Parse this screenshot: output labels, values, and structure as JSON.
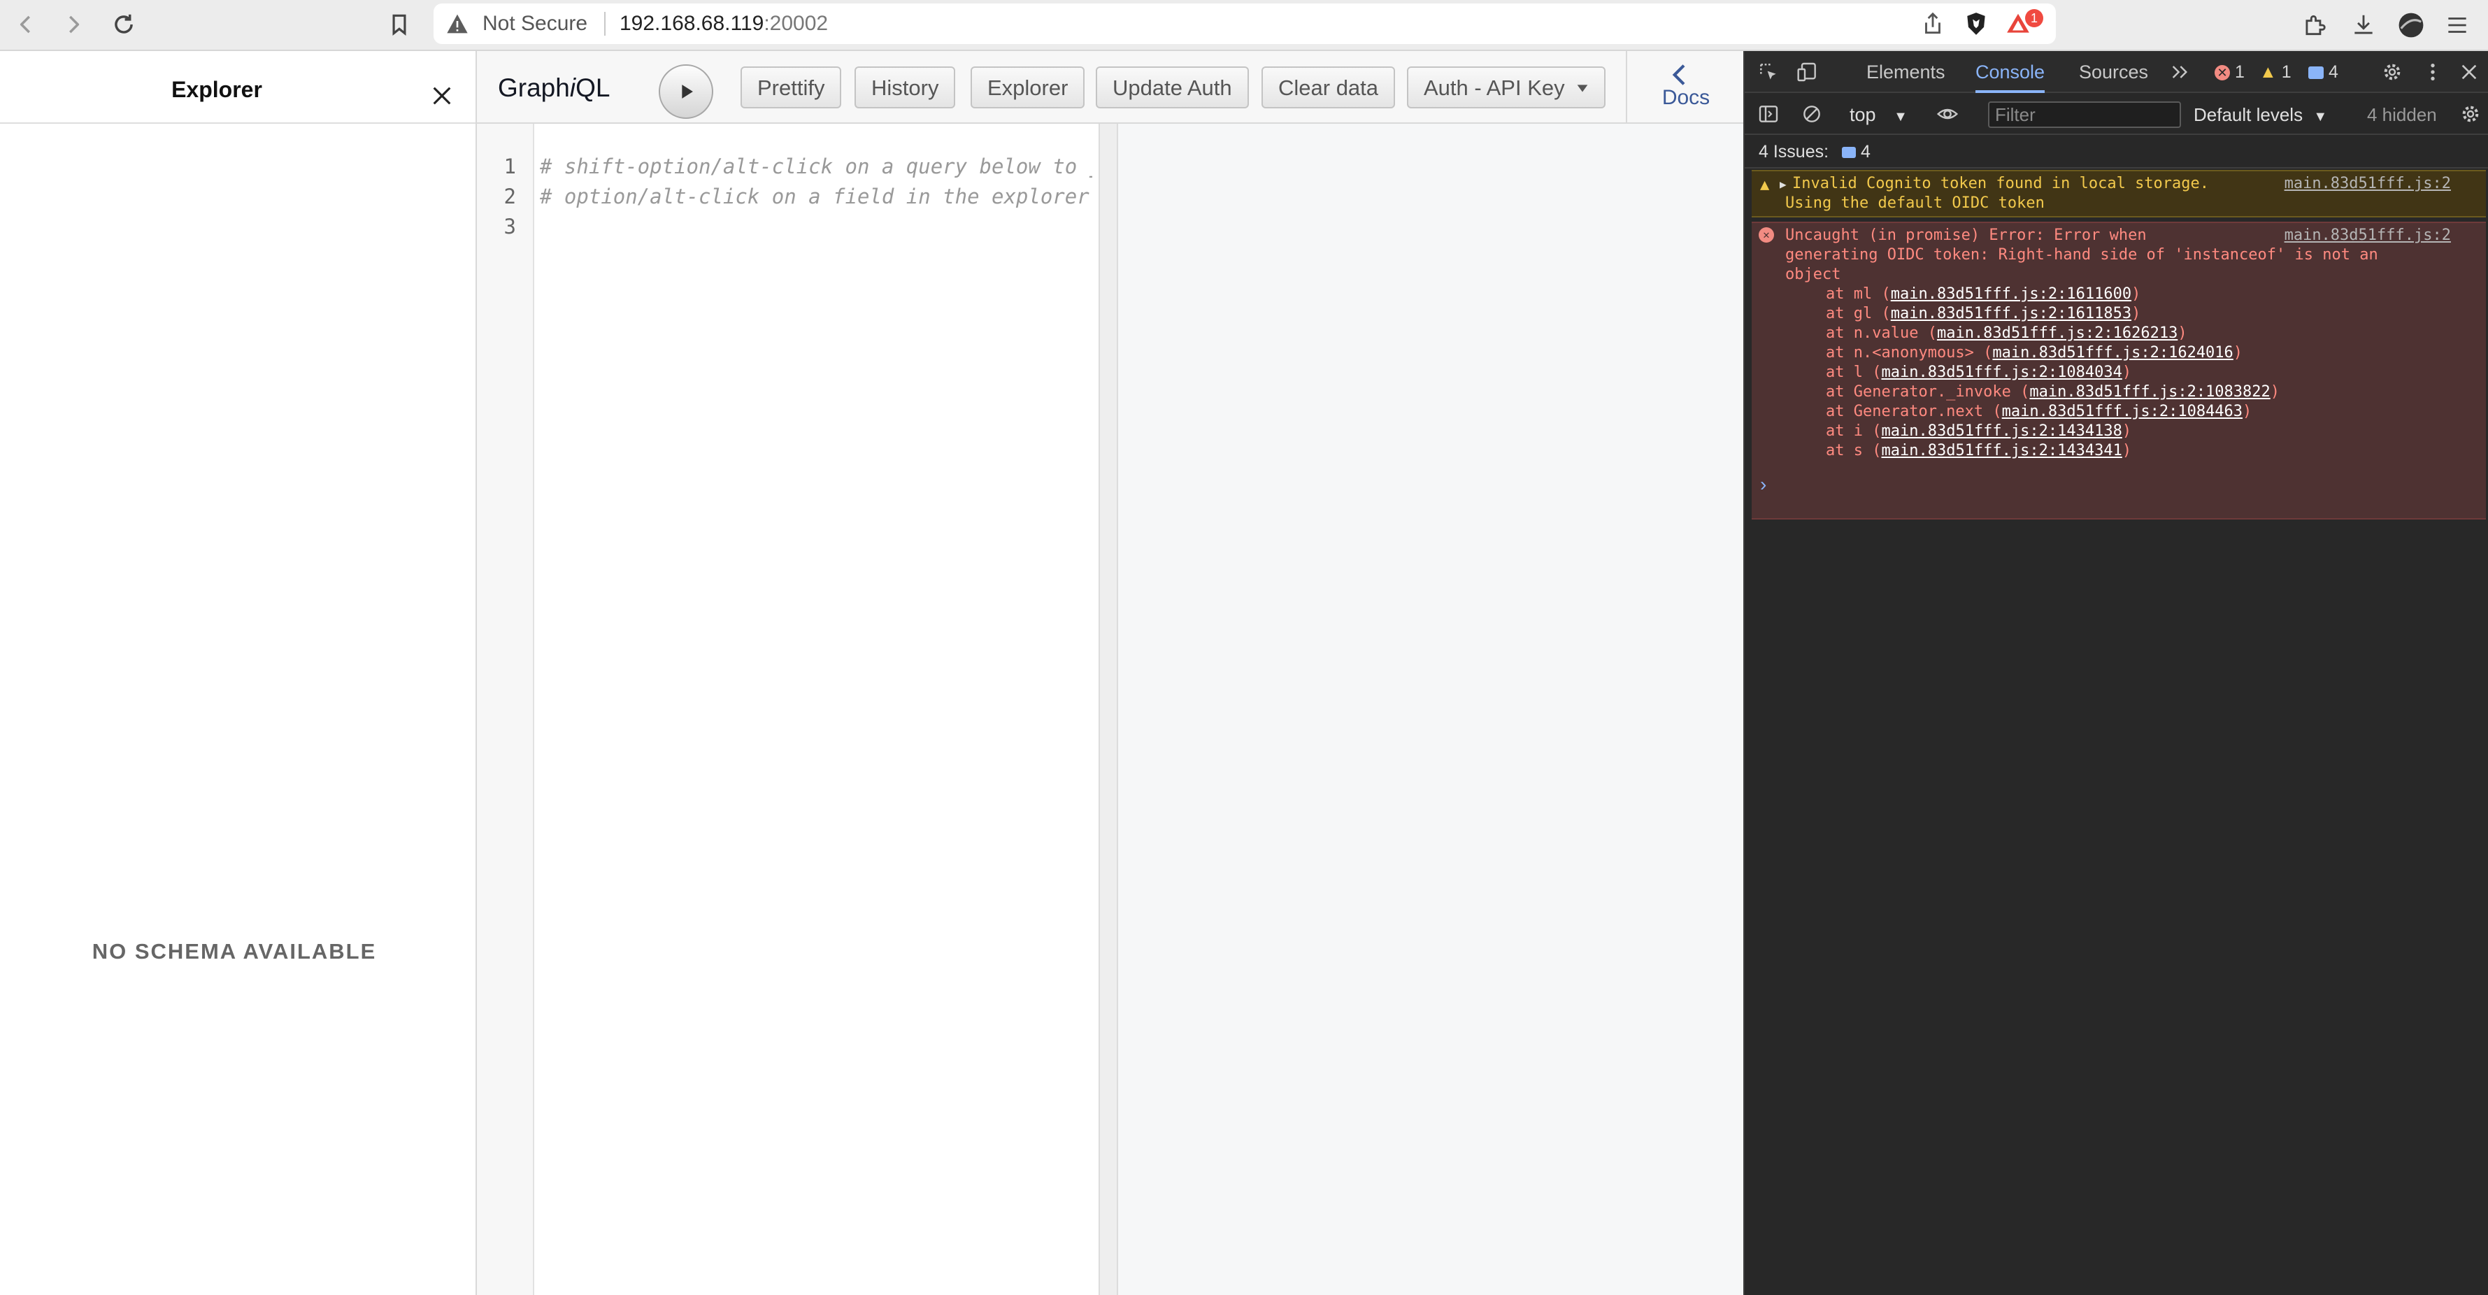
{
  "browser": {
    "security_label": "Not Secure",
    "url_host": "192.168.68.119",
    "url_port": ":20002",
    "brave_badge": "1"
  },
  "explorer": {
    "title": "Explorer",
    "empty_message": "NO SCHEMA AVAILABLE"
  },
  "graphiql": {
    "title_pre": "Graph",
    "title_i": "i",
    "title_post": "QL",
    "buttons": {
      "prettify": "Prettify",
      "history": "History",
      "explorer": "Explorer",
      "update_auth": "Update Auth",
      "clear_data": "Clear data",
      "auth_mode": "Auth - API Key"
    },
    "docs_label": "Docs",
    "editor_lines": [
      {
        "num": "1",
        "text": "# shift-option/alt-click on a query below to jum"
      },
      {
        "num": "2",
        "text": "# option/alt-click on a field in the explorer to"
      },
      {
        "num": "3",
        "text": ""
      }
    ]
  },
  "devtools": {
    "tabs": [
      "Elements",
      "Console",
      "Sources"
    ],
    "active_tab": "Console",
    "error_count": "1",
    "warning_count": "1",
    "info_count": "4",
    "context": "top",
    "filter_placeholder": "Filter",
    "levels": "Default levels",
    "hidden": "4 hidden",
    "issues_label": "4 Issues:",
    "issues_count": "4",
    "warning_message": {
      "line1": "Invalid Cognito token found in local storage.",
      "line2": "Using the default OIDC token",
      "source": "main.83d51fff.js:2"
    },
    "error_message": {
      "line1": "Uncaught (in promise) Error: Error when",
      "line2": "generating OIDC token: Right-hand side of 'instanceof' is not an",
      "line3": "object",
      "source": "main.83d51fff.js:2",
      "stack": [
        {
          "prefix": "at ml (",
          "link": "main.83d51fff.js:2:1611600"
        },
        {
          "prefix": "at gl (",
          "link": "main.83d51fff.js:2:1611853"
        },
        {
          "prefix": "at n.value (",
          "link": "main.83d51fff.js:2:1626213"
        },
        {
          "prefix": "at n.<anonymous> (",
          "link": "main.83d51fff.js:2:1624016"
        },
        {
          "prefix": "at l (",
          "link": "main.83d51fff.js:2:1084034"
        },
        {
          "prefix": "at Generator._invoke (",
          "link": "main.83d51fff.js:2:1083822"
        },
        {
          "prefix": "at Generator.next (",
          "link": "main.83d51fff.js:2:1084463"
        },
        {
          "prefix": "at i (",
          "link": "main.83d51fff.js:2:1434138"
        },
        {
          "prefix": "at s (",
          "link": "main.83d51fff.js:2:1434341"
        }
      ]
    }
  }
}
